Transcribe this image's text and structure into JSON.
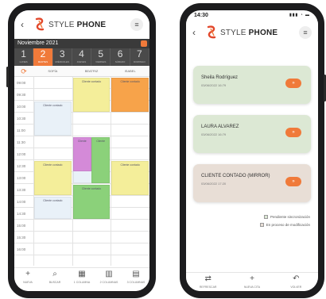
{
  "app": {
    "brand_light": "STYLE",
    "brand_bold": "PHONE",
    "back_glyph": "‹",
    "menu_glyph": "≡"
  },
  "calendar": {
    "month": "Noviembre 2021",
    "days": [
      {
        "num": "1",
        "name": "LUNES"
      },
      {
        "num": "2",
        "name": "MARTES",
        "active": true
      },
      {
        "num": "3",
        "name": "MIÉRCOLES"
      },
      {
        "num": "4",
        "name": "JUEVES"
      },
      {
        "num": "5",
        "name": "VIERNES"
      },
      {
        "num": "6",
        "name": "SÁBADO"
      },
      {
        "num": "7",
        "name": "DOMINGO"
      }
    ],
    "columns": [
      "SOFÍA",
      "BEATRIZ",
      "ISABEL"
    ],
    "times": [
      "09:00",
      "09:30",
      "10:00",
      "10:30",
      "11:00",
      "11:30",
      "12:00",
      "12:30",
      "13:00",
      "13:30",
      "14:00",
      "14:30",
      "15:00",
      "15:30",
      "16:00"
    ],
    "appointments": [
      {
        "col": 0,
        "start": 2,
        "span": 3,
        "color": "#e9f1f8",
        "text": "Cliente contado"
      },
      {
        "col": 1,
        "start": 0,
        "span": 3,
        "color": "#f4ee9a",
        "text": "Cliente contado"
      },
      {
        "col": 2,
        "start": 0,
        "span": 3,
        "color": "#f7a34a",
        "text": "Cliente contado"
      },
      {
        "col": 1,
        "start": 5,
        "span": 4,
        "color": "#e9f1f8",
        "text": ""
      },
      {
        "col": 1,
        "start": 5,
        "span": 3,
        "color": "#d48ad8",
        "text": "Cliente",
        "half": "left"
      },
      {
        "col": 1,
        "start": 5,
        "span": 4,
        "color": "#8bd17a",
        "text": "Cliente",
        "half": "right"
      },
      {
        "col": 0,
        "start": 7,
        "span": 3,
        "color": "#f4ee9a",
        "text": "Cliente contado"
      },
      {
        "col": 2,
        "start": 7,
        "span": 3,
        "color": "#f4ee9a",
        "text": "Cliente contado"
      },
      {
        "col": 1,
        "start": 9,
        "span": 3,
        "color": "#8bd17a",
        "text": "Cliente contado"
      },
      {
        "col": 0,
        "start": 10,
        "span": 2,
        "color": "#e9f1f8",
        "text": "Cliente contado"
      }
    ],
    "nav": [
      {
        "icon": "+",
        "label": "NUEVA",
        "name": "new-icon"
      },
      {
        "icon": "⌕",
        "label": "BUSCAR",
        "name": "search-icon"
      },
      {
        "icon": "▦",
        "label": "1 COLUMNA",
        "name": "one-column-icon"
      },
      {
        "icon": "▥",
        "label": "2 COLUMNAS",
        "name": "two-columns-icon"
      },
      {
        "icon": "▤",
        "label": "3 COLUMNAS",
        "name": "three-columns-icon"
      }
    ]
  },
  "list": {
    "time": "14:30",
    "status_icons": "▮▮▮ ◔ ▬",
    "cards": [
      {
        "name": "Sheila Rodríguez",
        "date": "03/06/2022 16:79",
        "color": "#dce8d4",
        "btn": "»"
      },
      {
        "name": "LAURA ALVAREZ",
        "date": "03/06/2022 16:79",
        "color": "#dce8d4",
        "btn": "»"
      },
      {
        "name": "CLIENTE CONTADO (MIRROR)",
        "date": "03/06/2022 17:20",
        "color": "#e8ded6",
        "btn": "»"
      }
    ],
    "legend": [
      {
        "label": "Pendiente sincronización",
        "color": "#dce8d4"
      },
      {
        "label": "En proceso de modificación",
        "color": "#e8ded6"
      }
    ],
    "nav": [
      {
        "icon": "⇄",
        "label": "REFRESCAR",
        "name": "refresh-icon"
      },
      {
        "icon": "+",
        "label": "NUEVA CITA",
        "name": "add-icon"
      },
      {
        "icon": "↶",
        "label": "VOLVER",
        "name": "undo-icon"
      }
    ]
  },
  "colors": {
    "accent": "#f07a3a",
    "dark_bar": "#3a3a3a"
  }
}
